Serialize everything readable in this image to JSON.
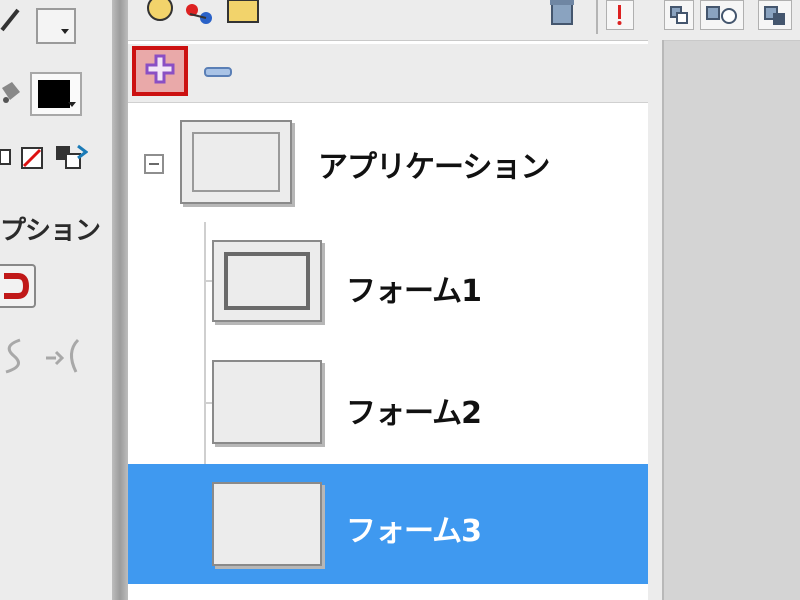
{
  "toolbox": {
    "options_label": "プション"
  },
  "scene_panel": {
    "add_icon": "plus-icon",
    "remove_icon": "minus-icon",
    "tree": [
      {
        "label": "アプリケーション",
        "type": "application",
        "expanded": true
      },
      {
        "label": "フォーム1",
        "type": "form",
        "selected": false
      },
      {
        "label": "フォーム2",
        "type": "form",
        "selected": false
      },
      {
        "label": "フォーム3",
        "type": "form",
        "selected": true
      }
    ]
  },
  "colors": {
    "selection": "#3f99f0",
    "highlight_border": "#cc1111",
    "add_button_bg": "#e9a9a9",
    "plus_icon": "#8a4fc4",
    "minus_icon": "#5a7fb6"
  }
}
